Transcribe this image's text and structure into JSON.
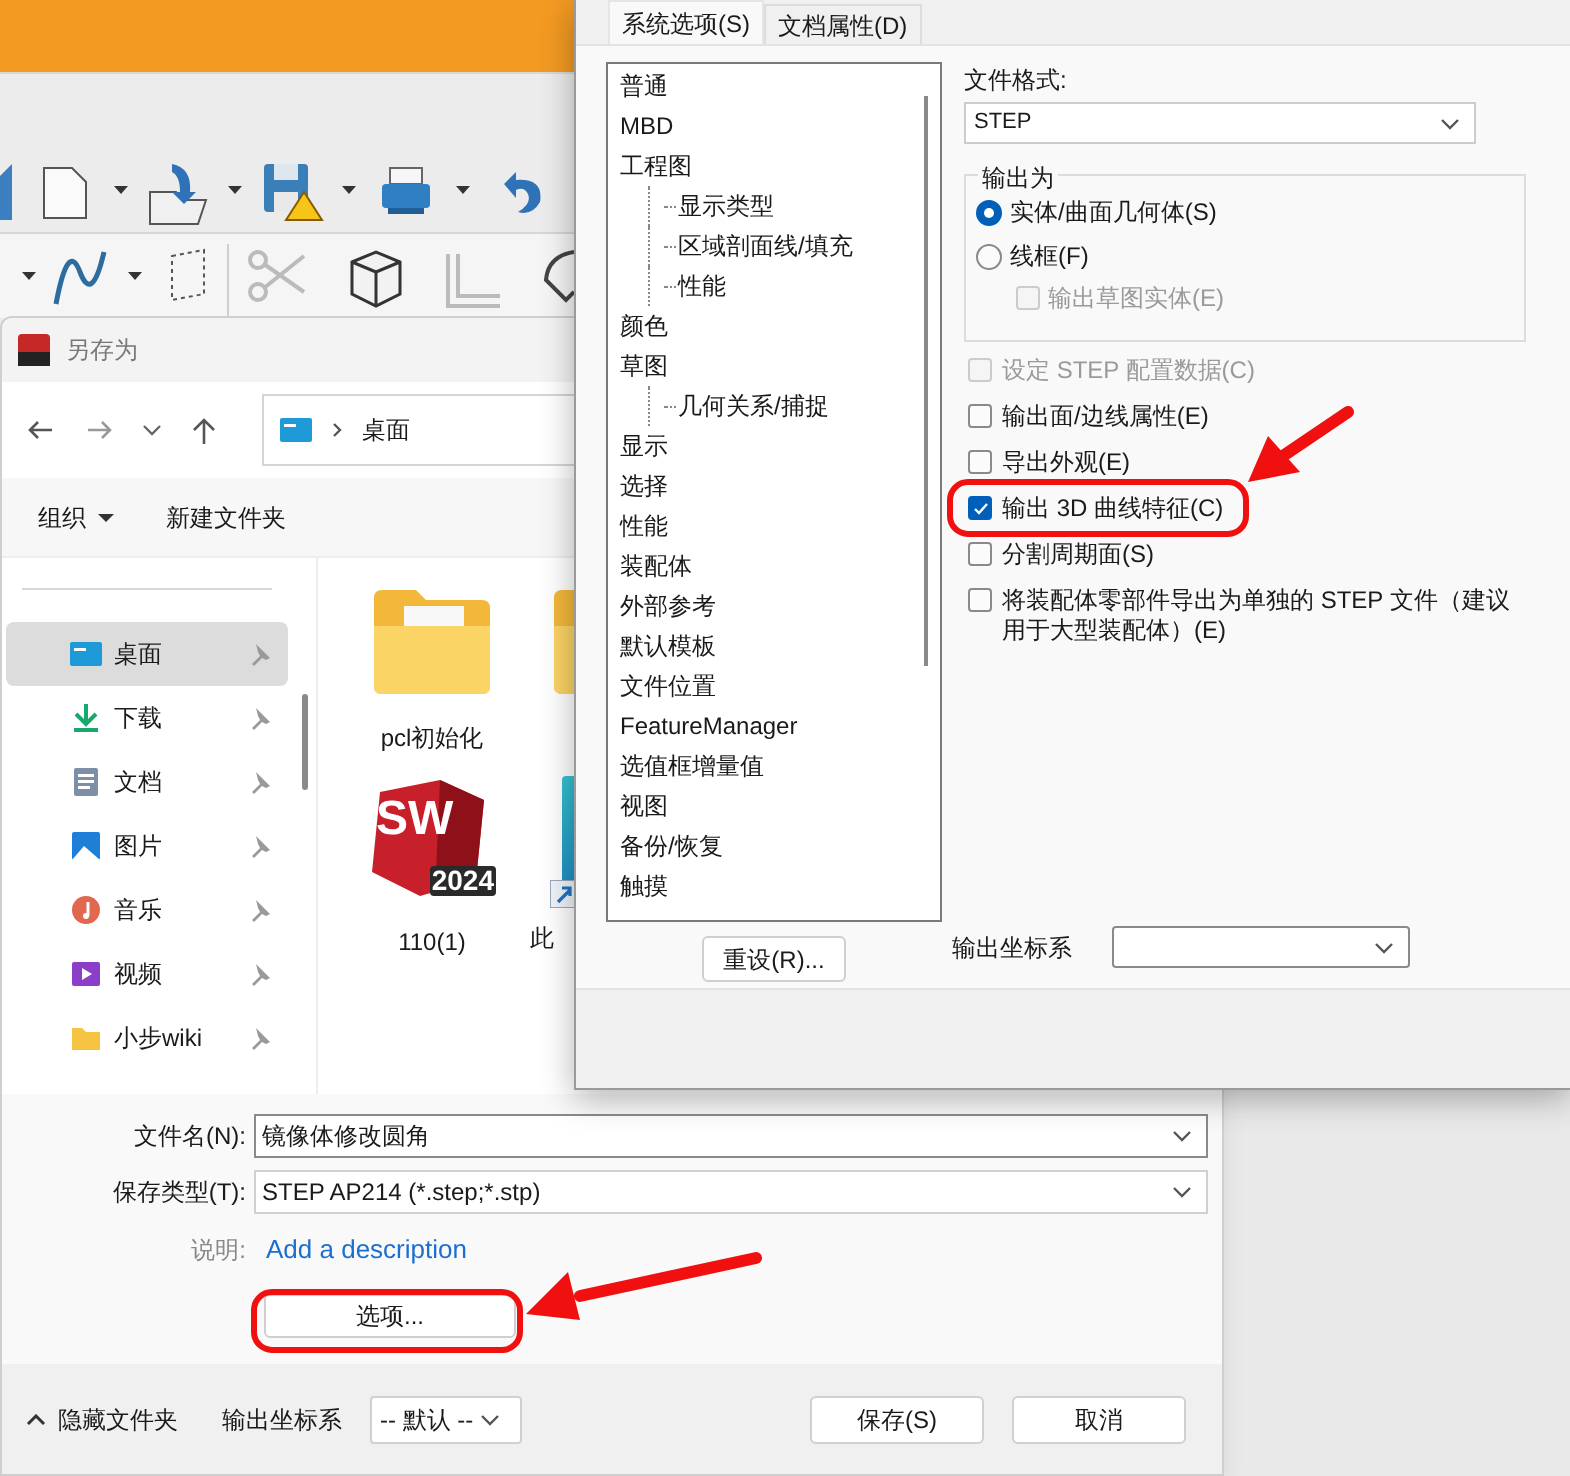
{
  "save_dialog": {
    "title": "另存为",
    "address": "桌面",
    "toolbar": [
      "组织",
      "新建文件夹"
    ],
    "sidebar": [
      {
        "label": "桌面",
        "selected": true
      },
      {
        "label": "下载",
        "selected": false
      },
      {
        "label": "文档",
        "selected": false
      },
      {
        "label": "图片",
        "selected": false
      },
      {
        "label": "音乐",
        "selected": false
      },
      {
        "label": "视频",
        "selected": false
      },
      {
        "label": "小步wiki",
        "selected": false
      }
    ],
    "files": [
      {
        "kind": "folder",
        "name": "pcl初始化"
      },
      {
        "kind": "folder"
      },
      {
        "kind": "app",
        "name": "110(1)",
        "logo": "SW",
        "badge": "2024"
      },
      {
        "kind": "shortcut",
        "name": "此"
      }
    ],
    "fields": [
      {
        "label": "文件名(N):",
        "value": "镜像体修改圆角"
      },
      {
        "label": "保存类型(T):",
        "value": "STEP AP214 (*.step;*.stp)"
      }
    ],
    "description": {
      "label": "说明:",
      "link": "Add a description"
    },
    "options_button": "选项...",
    "hide_folders": "隐藏文件夹",
    "coordinate_system": {
      "label": "输出坐标系",
      "value": "-- 默认 --"
    },
    "buttons": [
      "保存(S)",
      "取消"
    ]
  },
  "options_dialog": {
    "tabs": [
      {
        "label": "系统选项(S)",
        "selected": true
      },
      {
        "label": "文档属性(D)",
        "selected": false
      }
    ],
    "tree": [
      {
        "label": "普通"
      },
      {
        "label": "MBD"
      },
      {
        "label": "工程图",
        "children": [
          {
            "label": "显示类型"
          },
          {
            "label": "区域剖面线/填充"
          },
          {
            "label": "性能"
          }
        ]
      },
      {
        "label": "颜色"
      },
      {
        "label": "草图",
        "children": [
          {
            "label": "几何关系/捕捉"
          }
        ]
      },
      {
        "label": "显示"
      },
      {
        "label": "选择"
      },
      {
        "label": "性能"
      },
      {
        "label": "装配体"
      },
      {
        "label": "外部参考"
      },
      {
        "label": "默认模板"
      },
      {
        "label": "文件位置"
      },
      {
        "label": "FeatureManager"
      },
      {
        "label": "选值框增量值"
      },
      {
        "label": "视图"
      },
      {
        "label": "备份/恢复"
      },
      {
        "label": "触摸"
      }
    ],
    "reset_button": "重设(R)...",
    "file_format": {
      "label": "文件格式:",
      "value": "STEP"
    },
    "output_as": {
      "title": "输出为",
      "options": [
        {
          "label": "实体/曲面几何体(S)",
          "selected": true
        },
        {
          "label": "线框(F)",
          "selected": false
        }
      ],
      "sub_option": {
        "label": "输出草图实体(E)",
        "checked": false,
        "disabled": true
      }
    },
    "checkboxes": [
      {
        "label": "设定 STEP 配置数据(C)",
        "checked": false,
        "disabled": true
      },
      {
        "label": "输出面/边线属性(E)",
        "checked": false,
        "disabled": false
      },
      {
        "label": "导出外观(E)",
        "checked": false,
        "disabled": false
      },
      {
        "label": "输出 3D 曲线特征(C)",
        "checked": true,
        "disabled": false
      },
      {
        "label": "分割周期面(S)",
        "checked": false,
        "disabled": false
      },
      {
        "label": "将装配体零部件导出为单独的 STEP 文件（建议用于大型装配体）(E)",
        "checked": false,
        "disabled": false
      }
    ],
    "coordinate_system": {
      "label": "输出坐标系"
    }
  }
}
